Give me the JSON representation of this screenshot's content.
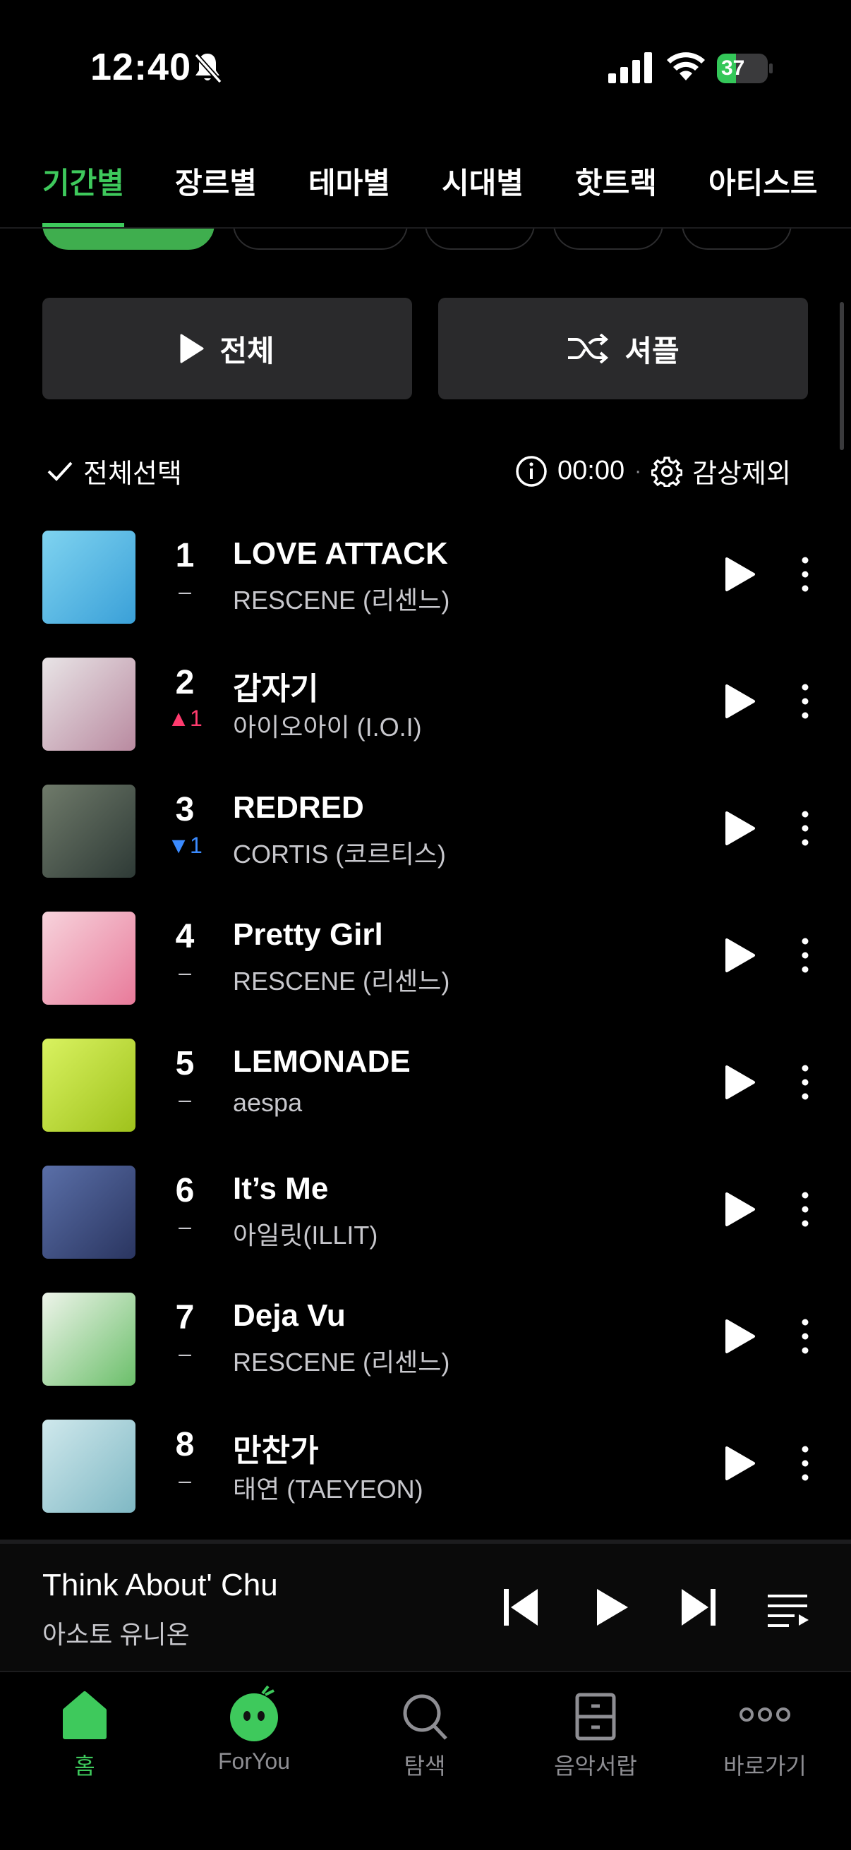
{
  "status_bar": {
    "time": "12:40",
    "battery": "37",
    "battery_level": 0.37
  },
  "tabs": [
    {
      "label": "기간별",
      "active": true
    },
    {
      "label": "장르별",
      "active": false
    },
    {
      "label": "테마별",
      "active": false
    },
    {
      "label": "시대별",
      "active": false
    },
    {
      "label": "핫트랙",
      "active": false
    },
    {
      "label": "아티스트",
      "active": false
    }
  ],
  "actions": {
    "play_all": "전체",
    "shuffle": "셔플"
  },
  "select_row": {
    "select_all": "전체선택",
    "timer": "00:00",
    "exclude": "감상제외"
  },
  "chart": [
    {
      "rank": "1",
      "change": "–",
      "change_type": "same",
      "title": "LOVE ATTACK",
      "artist": "RESCENE (리센느)",
      "art_colors": [
        "#7fd3f0",
        "#3aa0d8"
      ]
    },
    {
      "rank": "2",
      "change": "▲1",
      "change_type": "up",
      "title": "갑자기",
      "artist": "아이오아이 (I.O.I)",
      "art_colors": [
        "#e8e4e6",
        "#b98aa0"
      ]
    },
    {
      "rank": "3",
      "change": "▼1",
      "change_type": "down",
      "title": "REDRED",
      "artist": "CORTIS (코르티스)",
      "art_colors": [
        "#6f7a6a",
        "#2e3a36"
      ]
    },
    {
      "rank": "4",
      "change": "–",
      "change_type": "same",
      "title": "Pretty Girl",
      "artist": "RESCENE (리센느)",
      "art_colors": [
        "#f7d3dc",
        "#e87a9a"
      ]
    },
    {
      "rank": "5",
      "change": "–",
      "change_type": "same",
      "title": "LEMONADE",
      "artist": "aespa",
      "art_colors": [
        "#d9f260",
        "#9fc21c"
      ]
    },
    {
      "rank": "6",
      "change": "–",
      "change_type": "same",
      "title": "It’s Me",
      "artist": "아일릿(ILLIT)",
      "art_colors": [
        "#5a6fa8",
        "#2a3560"
      ]
    },
    {
      "rank": "7",
      "change": "–",
      "change_type": "same",
      "title": "Deja Vu",
      "artist": "RESCENE (리센느)",
      "art_colors": [
        "#eef4ea",
        "#6bbf6a"
      ]
    },
    {
      "rank": "8",
      "change": "–",
      "change_type": "same",
      "title": "만찬가",
      "artist": "태연 (TAEYEON)",
      "art_colors": [
        "#cfe8ec",
        "#7fb8c4"
      ]
    }
  ],
  "now_playing": {
    "title": "Think About' Chu",
    "artist": "아소토 유니온"
  },
  "bottom_nav": [
    {
      "label": "홈",
      "icon": "home-icon",
      "active": true
    },
    {
      "label": "ForYou",
      "icon": "foryou-character-icon",
      "active": false
    },
    {
      "label": "탐색",
      "icon": "search-icon",
      "active": false
    },
    {
      "label": "음악서랍",
      "icon": "drawer-icon",
      "active": false
    },
    {
      "label": "바로가기",
      "icon": "more-dots-icon",
      "active": false
    }
  ],
  "colors": {
    "accent": "#3ec95c",
    "up": "#ff3b6e",
    "down": "#3b8bff",
    "button_bg": "#2a2a2c"
  }
}
